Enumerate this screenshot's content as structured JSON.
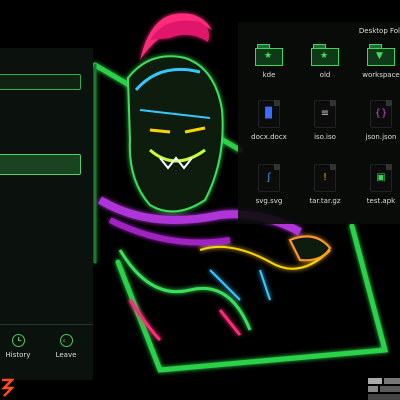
{
  "login_panel": {
    "buttons": [
      {
        "label": "History",
        "icon": "clock-icon"
      },
      {
        "label": "Leave",
        "icon": "back-arrow-icon"
      }
    ]
  },
  "desktop": {
    "title": "Desktop Fol",
    "items": [
      {
        "label": "kde",
        "icon": "folder-icon",
        "color": "#3cd65a"
      },
      {
        "label": "old",
        "icon": "folder-icon",
        "color": "#3cd65a"
      },
      {
        "label": "workspace",
        "icon": "folder-icon",
        "color": "#3cd65a"
      },
      {
        "label": "docx.docx",
        "icon": "document-icon",
        "color": "#3a6cff"
      },
      {
        "label": "iso.iso",
        "icon": "text-file-icon",
        "color": "#cccccc"
      },
      {
        "label": "json.json",
        "icon": "code-file-icon",
        "color": "#d040d0"
      },
      {
        "label": "svg.svg",
        "icon": "vector-file-icon",
        "color": "#4aa0ff"
      },
      {
        "label": "tar.tar.gz",
        "icon": "warning-file-icon",
        "color": "#e0b000"
      },
      {
        "label": "test.apk",
        "icon": "android-file-icon",
        "color": "#3cd65a"
      }
    ]
  },
  "colors": {
    "accent": "#3cd65a",
    "panel": "#0c120e"
  }
}
